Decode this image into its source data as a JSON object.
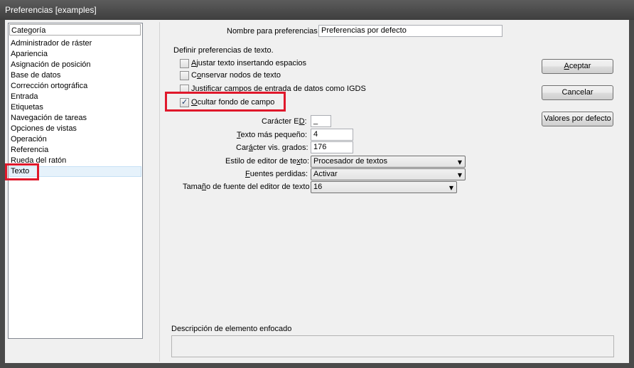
{
  "window": {
    "title": "Preferencias [examples]"
  },
  "sidebar": {
    "header": "Categoría",
    "items": [
      {
        "label": "Administrador de ráster"
      },
      {
        "label": "Apariencia"
      },
      {
        "label": "Asignación de posición"
      },
      {
        "label": "Base de datos"
      },
      {
        "label": "Corrección ortográfica"
      },
      {
        "label": "Entrada"
      },
      {
        "label": "Etiquetas"
      },
      {
        "label": "Navegación de tareas"
      },
      {
        "label": "Opciones de vistas"
      },
      {
        "label": "Operación"
      },
      {
        "label": "Referencia"
      },
      {
        "label": "Rueda del ratón"
      },
      {
        "label": "Texto",
        "selected": true
      }
    ]
  },
  "prefs": {
    "name_label": "Nombre para preferencias",
    "name_value": "Preferencias por defecto",
    "section_label": "Definir preferencias de texto.",
    "checkboxes": [
      {
        "mn": "A",
        "rest": "justar texto insertando espacios",
        "checked": false
      },
      {
        "pre": "C",
        "mn": "o",
        "rest": "nservar nodos de texto",
        "checked": false
      },
      {
        "mn": "J",
        "rest": "ustificar campos de entrada de datos como IGDS",
        "checked": false
      },
      {
        "mn": "O",
        "rest": "cultar fondo de campo",
        "checked": true
      }
    ],
    "fields": {
      "ed_char": {
        "label_pre": "Carácter E",
        "label_mn": "D",
        "label_post": ":",
        "value": "_"
      },
      "smallest_text": {
        "label_mn": "T",
        "label_post": "exto más pequeño:",
        "value": "4"
      },
      "view_degrees": {
        "label_pre": "Car",
        "label_mn": "á",
        "label_post": "cter vis. grados:",
        "value": "176"
      }
    },
    "combos": {
      "editor_style": {
        "label_pre": "Estilo de editor de te",
        "label_mn": "x",
        "label_post": "to:",
        "value": "Procesador de textos"
      },
      "missing_fonts": {
        "label_mn": "F",
        "label_post": "uentes perdidas:",
        "value": "Activar"
      },
      "editor_font_size": {
        "label_pre": "Tama",
        "label_mn": "ñ",
        "label_post": "o de fuente del editor de texto",
        "value": "16"
      }
    },
    "description_label": "Descripción de elemento enfocado"
  },
  "buttons": {
    "accept_mn": "A",
    "accept_rest": "ceptar",
    "cancel": "Cancelar",
    "defaults": "Valores por defecto"
  }
}
